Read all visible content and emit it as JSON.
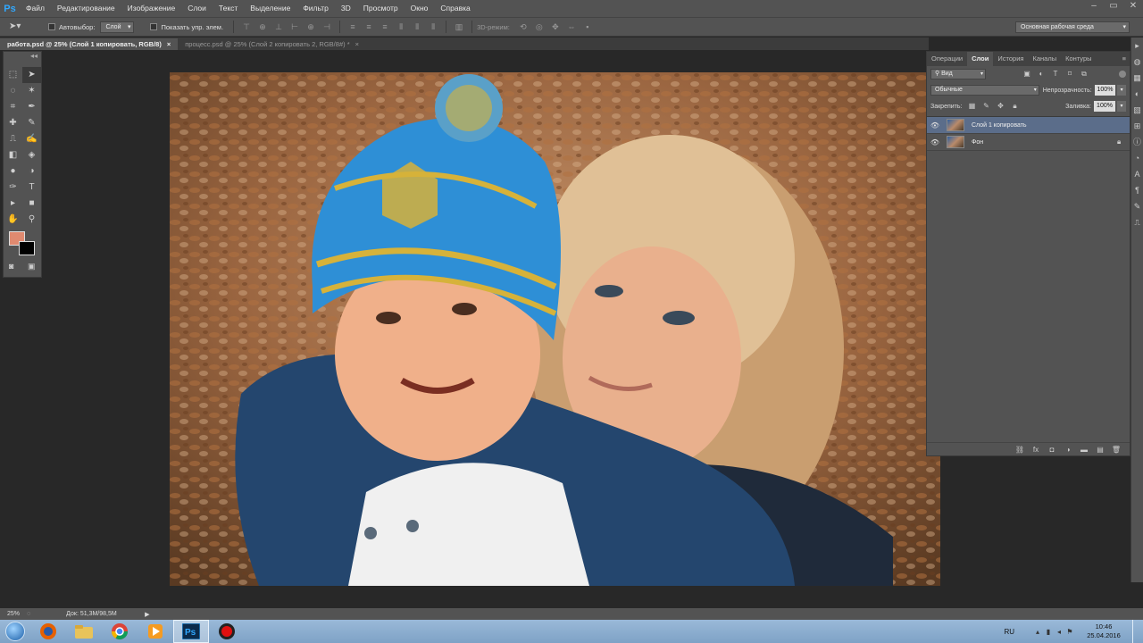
{
  "app": {
    "logo": "Ps"
  },
  "menu": [
    "Файл",
    "Редактирование",
    "Изображение",
    "Слои",
    "Текст",
    "Выделение",
    "Фильтр",
    "3D",
    "Просмотр",
    "Окно",
    "Справка"
  ],
  "window_controls": {
    "minimize": "–",
    "restore": "▭",
    "close": "✕"
  },
  "options_bar": {
    "autoselect_label": "Автовыбор:",
    "autoselect_value": "Слой",
    "show_controls_label": "Показать упр. элем.",
    "mode_3d_label": "3D-режим:",
    "workspace": "Основная рабочая среда"
  },
  "doc_tabs": [
    {
      "label": "работа.psd @ 25% (Слой 1 копировать, RGB/8)",
      "close": "×"
    },
    {
      "label": "процесс.psd @ 25% (Слой 2 копировать 2, RGB/8#) *",
      "close": "×"
    }
  ],
  "toolbox": {
    "collapse": "◂◂",
    "tools": [
      [
        "marquee-icon",
        "move-icon"
      ],
      [
        "lasso-icon",
        "magic-wand-icon"
      ],
      [
        "crop-icon",
        "eyedropper-icon"
      ],
      [
        "healing-brush-icon",
        "brush-icon"
      ],
      [
        "clone-stamp-icon",
        "history-brush-icon"
      ],
      [
        "eraser-icon",
        "paint-bucket-icon"
      ],
      [
        "blur-icon",
        "dodge-icon"
      ],
      [
        "pen-icon",
        "type-icon"
      ],
      [
        "path-selection-icon",
        "rectangle-icon"
      ],
      [
        "hand-icon",
        "zoom-icon"
      ]
    ],
    "glyphs": [
      [
        "⬚",
        "➤"
      ],
      [
        "◌",
        "✶"
      ],
      [
        "⌗",
        "✒"
      ],
      [
        "✚",
        "✎"
      ],
      [
        "⎍",
        "✍"
      ],
      [
        "◧",
        "◈"
      ],
      [
        "●",
        "◑"
      ],
      [
        "✑",
        "T"
      ],
      [
        "▸",
        "■"
      ],
      [
        "✋",
        "⚲"
      ]
    ],
    "fg_color": "#e08a70",
    "bg_color": "#000000"
  },
  "panel": {
    "tabs": [
      "Операции",
      "Слои",
      "История",
      "Каналы",
      "Контуры"
    ],
    "active_tab": "Слои",
    "filter_kind": "Вид",
    "blend_mode": "Обычные",
    "opacity_label": "Непрозрачность:",
    "opacity_value": "100%",
    "lock_label": "Закрепить:",
    "fill_label": "Заливка:",
    "fill_value": "100%",
    "layers": [
      {
        "name": "Слой 1 копировать",
        "selected": true,
        "locked": false
      },
      {
        "name": "Фон",
        "selected": false,
        "locked": true
      }
    ]
  },
  "status": {
    "zoom": "25%",
    "doc_info": "Док: 51,3M/98,5M"
  },
  "taskbar": {
    "apps": [
      "explorer-icon",
      "firefox-icon",
      "folder-icon",
      "chrome-icon",
      "media-player-icon",
      "photoshop-icon",
      "recorder-icon"
    ],
    "active_app": "photoshop-icon",
    "lang": "RU",
    "time": "10:46",
    "date": "25.04.2016"
  }
}
